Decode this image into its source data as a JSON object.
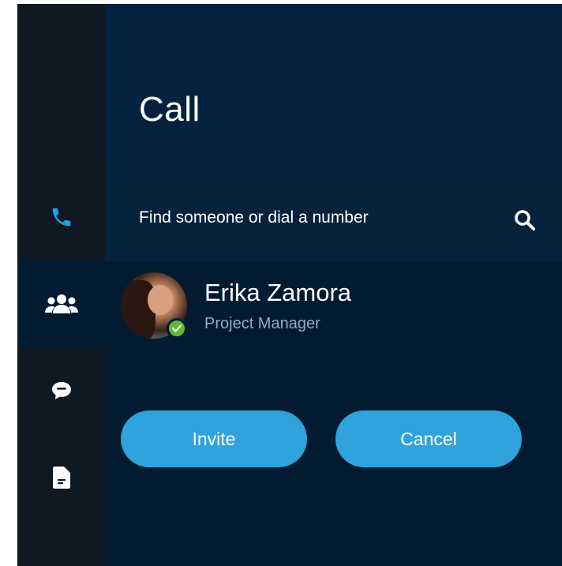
{
  "header": {
    "title": "Call"
  },
  "search": {
    "placeholder": "Find someone or dial a number"
  },
  "contact": {
    "name": "Erika Zamora",
    "role": "Project Manager",
    "status": "available"
  },
  "actions": {
    "invite_label": "Invite",
    "cancel_label": "Cancel"
  },
  "rail": {
    "items": [
      {
        "icon": "phone-icon",
        "active": false
      },
      {
        "icon": "people-icon",
        "active": true
      },
      {
        "icon": "chat-icon",
        "active": false
      },
      {
        "icon": "document-icon",
        "active": false
      }
    ]
  },
  "colors": {
    "accent": "#2ea3dc",
    "phone_icon": "#1e9fe8",
    "status_available": "#5fbb2d",
    "background": "#021b31",
    "rail_background": "#0f1923"
  }
}
